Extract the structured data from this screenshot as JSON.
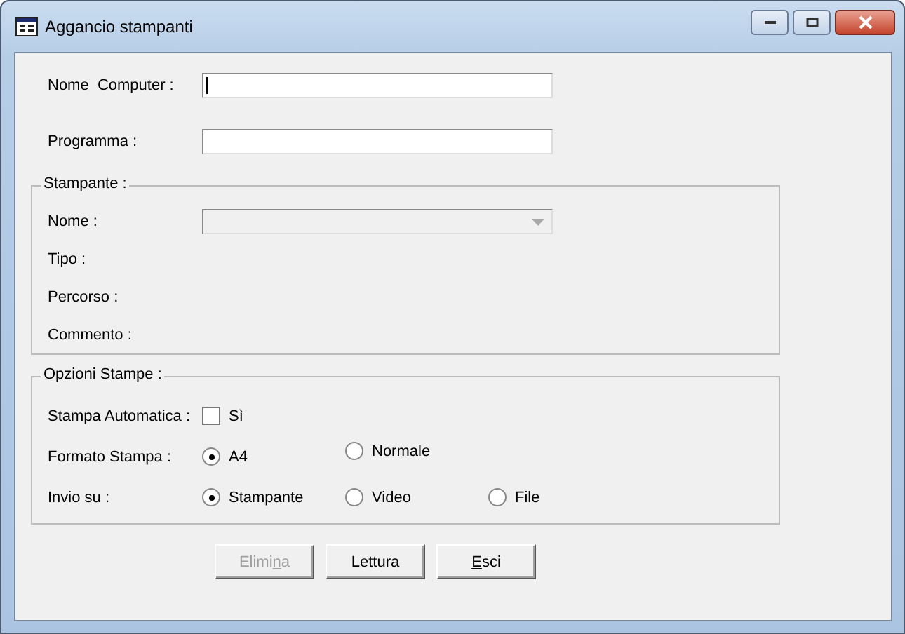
{
  "window": {
    "title": "Aggancio stampanti"
  },
  "fields": [
    {
      "label": "Nome  Computer :",
      "focused": true
    },
    {
      "label": "Programma :",
      "focused": false
    }
  ],
  "printer_group": {
    "title": "Stampante :",
    "name_label": "Nome :",
    "name_disabled": true,
    "info_labels": [
      "Tipo :",
      "Percorso :",
      "Commento :"
    ]
  },
  "options_group": {
    "title": "Opzioni Stampe :",
    "auto_print": {
      "label": "Stampa Automatica :",
      "option": "Sì",
      "checked": false
    },
    "format": {
      "label": "Formato Stampa :",
      "options": [
        {
          "label": "A4",
          "selected": true
        },
        {
          "label": "Normale",
          "selected": false
        }
      ]
    },
    "send_to": {
      "label": "Invio su :",
      "options": [
        {
          "label": "Stampante",
          "selected": true
        },
        {
          "label": "Video",
          "selected": false
        },
        {
          "label": "File",
          "selected": false
        }
      ]
    }
  },
  "buttons": [
    {
      "label": "Elimina",
      "disabled": true
    },
    {
      "label": "Lettura",
      "disabled": false
    },
    {
      "label": "Esci",
      "disabled": false
    }
  ]
}
